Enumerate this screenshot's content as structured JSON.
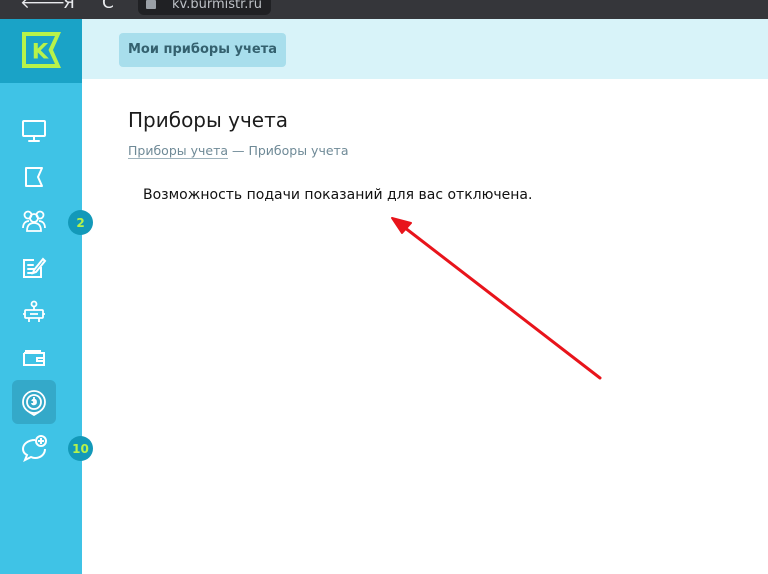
{
  "browser": {
    "back_glyph": "🡐",
    "yandex_glyph": "Я",
    "reload_glyph": "C",
    "url": "kv.burmistr.ru"
  },
  "logo": {
    "letter": "K",
    "accent": "#b7f34a"
  },
  "sidebar": {
    "items": [
      {
        "name": "monitor-icon",
        "badge": ""
      },
      {
        "name": "flag-icon",
        "badge": ""
      },
      {
        "name": "users-icon",
        "badge": "2"
      },
      {
        "name": "note-edit-icon",
        "badge": ""
      },
      {
        "name": "service-icon",
        "badge": ""
      },
      {
        "name": "wallet-icon",
        "badge": ""
      },
      {
        "name": "meter-icon",
        "badge": "",
        "active": true
      },
      {
        "name": "chat-add-icon",
        "badge": "10"
      }
    ]
  },
  "topbar": {
    "tab_label": "Мои приборы учета"
  },
  "main": {
    "title": "Приборы учета",
    "breadcrumb": {
      "link": "Приборы учета",
      "separator": " — ",
      "current": "Приборы учета"
    },
    "message": "Возможность подачи показаний для вас отключена."
  },
  "colors": {
    "sidebar": "#3fc3e6",
    "logo_bg": "#1aa3c7",
    "topbar": "#d8f3f9",
    "badge_bg": "#1399b9",
    "arrow": "#e8141b"
  }
}
